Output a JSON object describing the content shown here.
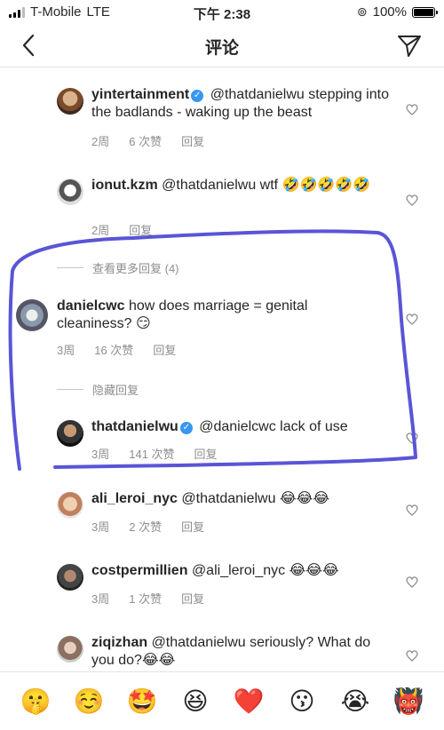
{
  "status_bar": {
    "carrier": "T-Mobile",
    "network": "LTE",
    "time": "下午 2:38",
    "battery": "100%",
    "signal_bars": 3
  },
  "nav": {
    "title": "评论"
  },
  "comments": [
    {
      "user": "yintertainment",
      "verified": true,
      "text": "@thatdanielwu stepping into the badlands - waking up the beast",
      "age": "2周",
      "likes": "6 次赞",
      "reply": "回复"
    },
    {
      "user": "ionut.kzm",
      "verified": false,
      "text": "@thatdanielwu wtf 🤣🤣🤣🤣🤣",
      "age": "2周",
      "likes": "",
      "reply": "回复"
    },
    {
      "user": "danielcwc",
      "verified": false,
      "text": "how does marriage = genital cleaniness? 😏",
      "age": "3周",
      "likes": "16 次赞",
      "reply": "回复"
    },
    {
      "user": "thatdanielwu",
      "verified": true,
      "text": "@danielcwc lack of use",
      "age": "3周",
      "likes": "141 次赞",
      "reply": "回复"
    },
    {
      "user": "ali_leroi_nyc",
      "verified": false,
      "text": "@thatdanielwu 😂😂😂",
      "age": "3周",
      "likes": "2 次赞",
      "reply": "回复"
    },
    {
      "user": "costpermillien",
      "verified": false,
      "text": "@ali_leroi_nyc 😂😂😂",
      "age": "3周",
      "likes": "1 次赞",
      "reply": "回复"
    },
    {
      "user": "ziqizhan",
      "verified": false,
      "text": "@thatdanielwu seriously? What do you do?😂😂",
      "age": "",
      "likes": "",
      "reply": ""
    }
  ],
  "thread": {
    "more_replies": "查看更多回复 (4)",
    "hide_replies": "隐藏回复"
  },
  "emoji_bar": [
    "🤫",
    "☺️",
    "🤩",
    "😆",
    "❤️",
    "😗",
    "😭",
    "👹"
  ],
  "colors": {
    "verified": "#3897f0",
    "meta": "#8e8e8e",
    "annotation": "#5a55d6"
  }
}
